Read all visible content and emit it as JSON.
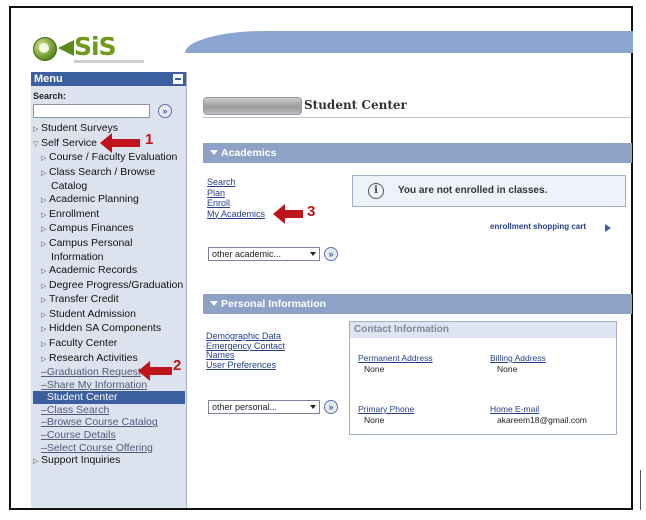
{
  "logo": {
    "text": "SiS"
  },
  "menu": {
    "title": "Menu",
    "search_label": "Search:",
    "search_value": "",
    "go_symbol": "»",
    "items": [
      {
        "label": "Student Surveys"
      },
      {
        "label": "Self Service"
      },
      {
        "label": "Course / Faculty Evaluation"
      },
      {
        "label": "Class Search / Browse"
      },
      {
        "label": "Catalog"
      },
      {
        "label": "Academic Planning"
      },
      {
        "label": "Enrollment"
      },
      {
        "label": "Campus Finances"
      },
      {
        "label": "Campus Personal"
      },
      {
        "label": "Information"
      },
      {
        "label": "Academic Records"
      },
      {
        "label": "Degree Progress/Graduation"
      },
      {
        "label": "Transfer Credit"
      },
      {
        "label": "Student Admission"
      },
      {
        "label": "Hidden SA Components"
      },
      {
        "label": "Faculty Center"
      },
      {
        "label": "Research Activities"
      },
      {
        "label": "Graduation Request"
      },
      {
        "label": "Share My Information"
      },
      {
        "label": "Student Center"
      },
      {
        "label": "Class Search"
      },
      {
        "label": "Browse Course Catalog"
      },
      {
        "label": "Course Details"
      },
      {
        "label": "Select Course Offering"
      },
      {
        "label": "Support Inquiries"
      }
    ]
  },
  "annotations": {
    "one": "1",
    "two": "2",
    "three": "3"
  },
  "page": {
    "title": "Student Center"
  },
  "academics": {
    "header": "Academics",
    "links": [
      "Search",
      "Plan",
      "Enroll",
      "My Academics"
    ],
    "select_value": "other academic...",
    "notice": "You are not enrolled in classes.",
    "info_symbol": "i",
    "cart_link": "enrollment shopping cart"
  },
  "personal": {
    "header": "Personal Information",
    "links": [
      "Demographic Data",
      "Emergency Contact",
      "Names",
      "User Preferences"
    ],
    "select_value": "other personal...",
    "contact": {
      "title": "Contact Information",
      "permanent_address_label": "Permanent Address",
      "permanent_address_value": "None",
      "billing_address_label": "Billing Address",
      "billing_address_value": "None",
      "primary_phone_label": "Primary Phone",
      "primary_phone_value": "None",
      "home_email_label": "Home E-mail",
      "home_email_value": "akareem18@gmail.com"
    }
  },
  "colors": {
    "header_blue": "#3c5f9f",
    "section_bar": "#8ea2c8",
    "annotation_red": "#c0141c",
    "logo_green": "#6e9b1e"
  }
}
